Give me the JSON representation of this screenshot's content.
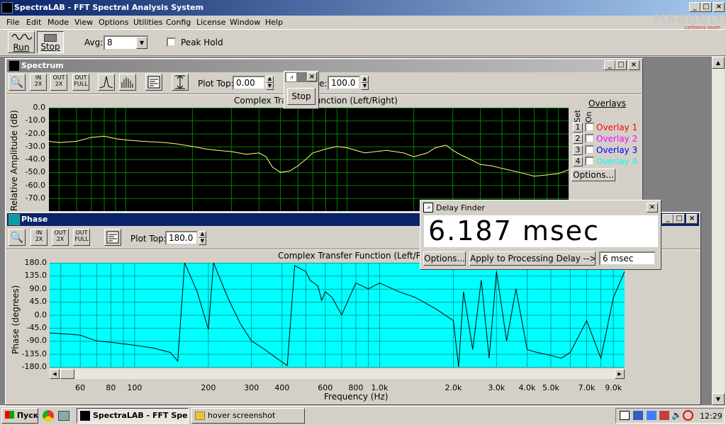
{
  "app": {
    "title": "SpectraLAB - FFT Spectral Analysis System",
    "watermark_top": "MAGNOLIA",
    "watermark_sub": "cartoons team"
  },
  "menu": [
    "File",
    "Edit",
    "Mode",
    "View",
    "Options",
    "Utilities",
    "Config",
    "License",
    "Window",
    "Help"
  ],
  "toolbar": {
    "run_label": "Run",
    "stop_label": "Stop",
    "avg_label": "Avg:",
    "avg_value": "8",
    "peak_hold_label": "Peak Hold"
  },
  "spectrum": {
    "title": "Spectrum",
    "plot_top_label": "Plot Top:",
    "plot_top_value": "0.00",
    "plot_range_label_tail": "e:",
    "plot_range_value": "100.0",
    "chart_title": "Complex Transfer Function (Left/Right)",
    "ylabel": "Relative Amplitude (dB)",
    "yticks": [
      "0.0",
      "-10.0",
      "-20.0",
      "-30.0",
      "-40.0",
      "-50.0",
      "-60.0",
      "-70.0"
    ],
    "overlays_title": "Overlays",
    "set_label": "Set",
    "on_label": "On",
    "overlays": [
      {
        "num": "1",
        "label": "Overlay 1",
        "color": "#ff0000"
      },
      {
        "num": "2",
        "label": "Overlay 2",
        "color": "#ff00ff"
      },
      {
        "num": "3",
        "label": "Overlay 3",
        "color": "#0000ff"
      },
      {
        "num": "4",
        "label": "Overlay 4",
        "color": "#00ffff"
      }
    ],
    "options_label": "Options..."
  },
  "stop_popup": {
    "stop_label": "Stop"
  },
  "phase": {
    "title": "Phase",
    "plot_top_label": "Plot Top:",
    "plot_top_value": "180.0",
    "chart_title": "Complex Transfer Function (Left/Right)",
    "ylabel": "Phase (degrees)",
    "xlabel": "Frequency (Hz)",
    "yticks": [
      "180.0",
      "135.0",
      "90.0",
      "45.0",
      "0.0",
      "-45.0",
      "-90.0",
      "-135.0",
      "-180.0"
    ],
    "xticks": [
      "60",
      "80",
      "100",
      "200",
      "300",
      "400",
      "600",
      "800",
      "1.0k",
      "2.0k",
      "3.0k",
      "4.0k",
      "5.0k",
      "7.0k",
      "9.0k"
    ]
  },
  "delay_finder": {
    "title": "Delay Finder",
    "value": "6.187 msec",
    "options_label": "Options...",
    "apply_label": "Apply to Processing Delay -->",
    "delay_value": "6 msec"
  },
  "taskbar": {
    "start_label": "Пуск",
    "tasks": [
      "SpectraLAB - FFT Spe...",
      "hover screenshot"
    ],
    "clock": "12:29"
  },
  "colors": {
    "titlebar": "#0a246a",
    "spectrum_bg": "#000000",
    "spectrum_grid": "#008000",
    "spectrum_trace": "#ffff80",
    "phase_bg": "#00ffff",
    "phase_grid": "#00a0a0",
    "phase_trace": "#000000"
  },
  "chart_data": [
    {
      "type": "line",
      "title": "Complex Transfer Function (Left/Right)",
      "ylabel": "Relative Amplitude (dB)",
      "xlabel": "",
      "ylim": [
        -80,
        0
      ],
      "x_scale": "log",
      "x": [
        40,
        50,
        60,
        70,
        80,
        90,
        100,
        120,
        150,
        170,
        200,
        230,
        260,
        300,
        350,
        400,
        430,
        460,
        500,
        550,
        600,
        650,
        700,
        800,
        900,
        1000,
        1200,
        1500,
        1800,
        2000,
        2300,
        2500,
        2800,
        3000,
        3300,
        3600,
        4000,
        4500,
        5000,
        6000,
        7000,
        8000,
        9000,
        10000
      ],
      "series": [
        {
          "values": [
            -25,
            -27,
            -26,
            -23,
            -22,
            -24,
            -25,
            -26,
            -27,
            -28,
            -30,
            -32,
            -33,
            -34,
            -36,
            -35,
            -38,
            -46,
            -50,
            -49,
            -45,
            -40,
            -35,
            -32,
            -30,
            -31,
            -35,
            -33,
            -35,
            -38,
            -35,
            -31,
            -29,
            -33,
            -37,
            -40,
            -44,
            -45,
            -47,
            -50,
            -53,
            -52,
            -51,
            -48
          ]
        }
      ]
    },
    {
      "type": "line",
      "title": "Complex Transfer Function (Left/Right)",
      "ylabel": "Phase (degrees)",
      "xlabel": "Frequency (Hz)",
      "ylim": [
        -180,
        180
      ],
      "x_scale": "log",
      "x": [
        40,
        50,
        60,
        70,
        80,
        100,
        120,
        140,
        150,
        160,
        180,
        200,
        210,
        240,
        270,
        300,
        340,
        380,
        420,
        450,
        500,
        520,
        560,
        580,
        600,
        640,
        700,
        800,
        900,
        1000,
        1200,
        1400,
        1700,
        2000,
        2100,
        2200,
        2400,
        2600,
        2800,
        3000,
        3300,
        3600,
        4000,
        4400,
        5000,
        5500,
        6000,
        7000,
        8000,
        9000,
        10000
      ],
      "series": [
        {
          "values": [
            -60,
            -65,
            -70,
            -90,
            -95,
            -105,
            -115,
            -130,
            -160,
            180,
            80,
            -50,
            180,
            60,
            -30,
            -90,
            -120,
            -150,
            -175,
            170,
            150,
            120,
            100,
            50,
            80,
            60,
            0,
            110,
            90,
            110,
            80,
            60,
            20,
            -20,
            -180,
            80,
            -120,
            120,
            -150,
            150,
            -90,
            90,
            -120,
            -130,
            -140,
            -150,
            -130,
            -20,
            -150,
            60,
            150
          ]
        }
      ]
    }
  ]
}
